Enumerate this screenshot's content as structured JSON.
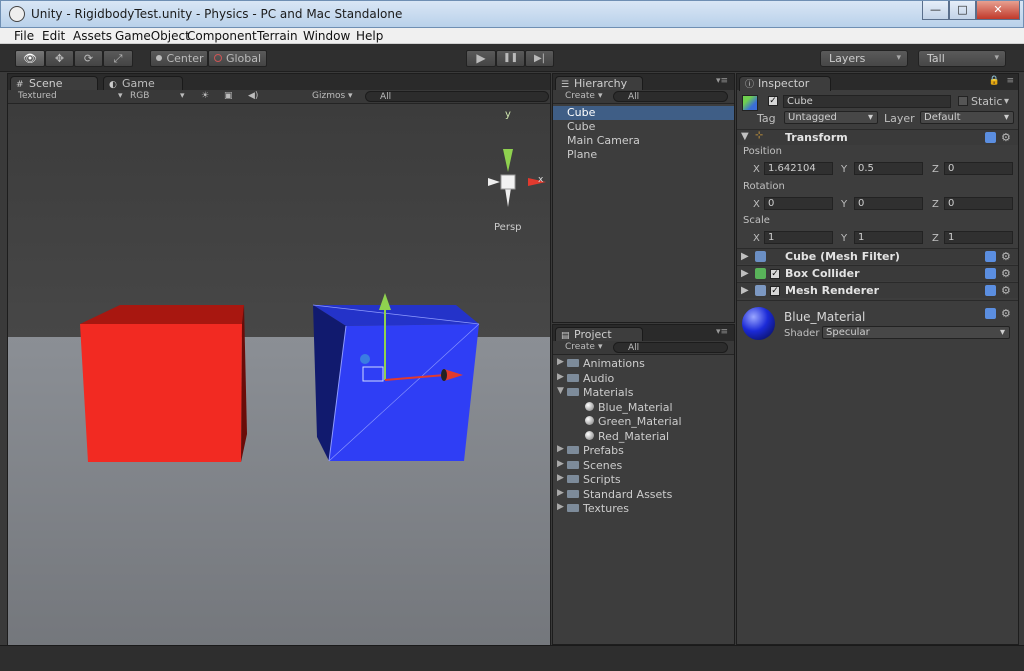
{
  "window": {
    "title": "Unity - RigidbodyTest.unity - Physics - PC and Mac Standalone",
    "min": "—",
    "max": "□",
    "close": "✕"
  },
  "menu": [
    "File",
    "Edit",
    "Assets",
    "GameObject",
    "Component",
    "Terrain",
    "Window",
    "Help"
  ],
  "toolbar": {
    "tools": [
      "👁",
      "✥",
      "⟳",
      "⤢"
    ],
    "pivot": "Center",
    "space": "Global",
    "play": "▶",
    "pause": "❚❚",
    "step": "▶|",
    "layers": "Layers",
    "layout": "Tall"
  },
  "scene_panel": {
    "tabs": [
      "Scene",
      "Game"
    ],
    "render_mode": "Textured",
    "color_mode": "RGB",
    "gizmos": "Gizmos",
    "search_placeholder": "All",
    "gizmo": {
      "axis_y": "y",
      "axis_x": "x",
      "projection": "Persp"
    }
  },
  "hierarchy": {
    "tab": "Hierarchy",
    "create": "Create",
    "search_placeholder": "All",
    "items": [
      "Cube",
      "Cube",
      "Main Camera",
      "Plane"
    ],
    "selected_index": 0
  },
  "project": {
    "tab": "Project",
    "create": "Create",
    "search_placeholder": "All",
    "folders": [
      {
        "name": "Animations",
        "expanded": false
      },
      {
        "name": "Audio",
        "expanded": false
      },
      {
        "name": "Materials",
        "expanded": true,
        "children": [
          "Blue_Material",
          "Green_Material",
          "Red_Material"
        ]
      },
      {
        "name": "Prefabs",
        "expanded": false
      },
      {
        "name": "Scenes",
        "expanded": false
      },
      {
        "name": "Scripts",
        "expanded": false
      },
      {
        "name": "Standard Assets",
        "expanded": false
      },
      {
        "name": "Textures",
        "expanded": false
      }
    ]
  },
  "inspector": {
    "tab": "Inspector",
    "object_name": "Cube",
    "static_label": "Static",
    "tag_label": "Tag",
    "tag": "Untagged",
    "layer_label": "Layer",
    "layer": "Default",
    "transform": {
      "title": "Transform",
      "position_label": "Position",
      "rotation_label": "Rotation",
      "scale_label": "Scale",
      "position": {
        "x": "1.642104",
        "y": "0.5",
        "z": "0"
      },
      "rotation": {
        "x": "0",
        "y": "0",
        "z": "0"
      },
      "scale": {
        "x": "1",
        "y": "1",
        "z": "1"
      },
      "axis_x": "X",
      "axis_y": "Y",
      "axis_z": "Z"
    },
    "components": [
      {
        "name": "Cube (Mesh Filter)",
        "checkbox": false
      },
      {
        "name": "Box Collider",
        "checkbox": true
      },
      {
        "name": "Mesh Renderer",
        "checkbox": true
      }
    ],
    "material": {
      "name": "Blue_Material",
      "shader_label": "Shader",
      "shader": "Specular"
    }
  },
  "colors": {
    "accent": "#3f5e86",
    "red_cube": "#f22a22",
    "blue_cube": "#2f3ef5"
  }
}
